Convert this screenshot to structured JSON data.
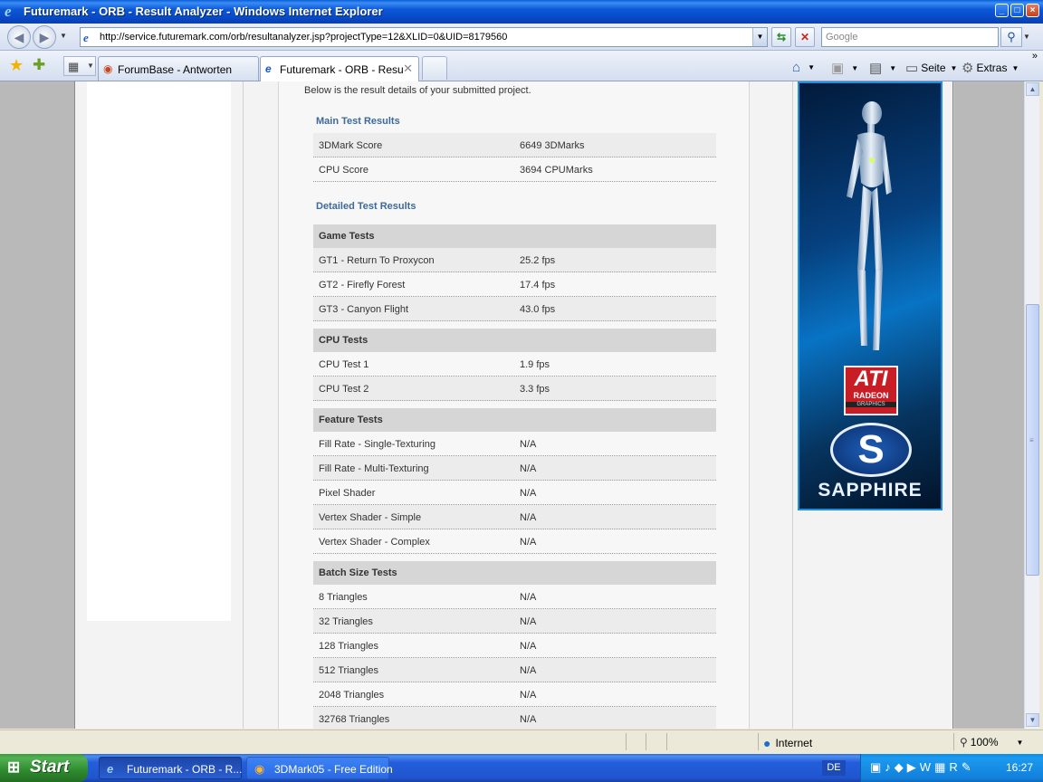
{
  "window": {
    "title": "Futuremark - ORB - Result Analyzer - Windows Internet Explorer",
    "buttons": [
      "_",
      "□",
      "×"
    ]
  },
  "address_bar": {
    "url": "http://service.futuremark.com/orb/resultanalyzer.jsp?projectType=12&XLID=0&UID=8179560",
    "search_placeholder": "Google"
  },
  "tabs": [
    {
      "label": "ForumBase - Antworten",
      "active": false
    },
    {
      "label": "Futuremark - ORB - Resul...",
      "active": true
    }
  ],
  "command_bar": {
    "page_label": "Seite",
    "tools_label": "Extras"
  },
  "page": {
    "intro": "Below is the result details of your submitted project.",
    "main_title": "Main Test Results",
    "main_rows": [
      {
        "k": "3DMark Score",
        "v": "6649 3DMarks"
      },
      {
        "k": "CPU Score",
        "v": "3694 CPUMarks"
      }
    ],
    "detailed_title": "Detailed Test Results",
    "groups": [
      {
        "title": "Game Tests",
        "rows": [
          {
            "k": "GT1 - Return To Proxycon",
            "v": "25.2 fps"
          },
          {
            "k": "GT2 - Firefly Forest",
            "v": "17.4 fps"
          },
          {
            "k": "GT3 - Canyon Flight",
            "v": "43.0 fps"
          }
        ]
      },
      {
        "title": "CPU Tests",
        "rows": [
          {
            "k": "CPU Test 1",
            "v": "1.9 fps"
          },
          {
            "k": "CPU Test 2",
            "v": "3.3 fps"
          }
        ]
      },
      {
        "title": "Feature Tests",
        "rows": [
          {
            "k": "Fill Rate - Single-Texturing",
            "v": "N/A"
          },
          {
            "k": "Fill Rate - Multi-Texturing",
            "v": "N/A"
          },
          {
            "k": "Pixel Shader",
            "v": "N/A"
          },
          {
            "k": "Vertex Shader - Simple",
            "v": "N/A"
          },
          {
            "k": "Vertex Shader - Complex",
            "v": "N/A"
          }
        ]
      },
      {
        "title": "Batch Size Tests",
        "rows": [
          {
            "k": "8 Triangles",
            "v": "N/A"
          },
          {
            "k": "32 Triangles",
            "v": "N/A"
          },
          {
            "k": "128 Triangles",
            "v": "N/A"
          },
          {
            "k": "512 Triangles",
            "v": "N/A"
          },
          {
            "k": "2048 Triangles",
            "v": "N/A"
          },
          {
            "k": "32768 Triangles",
            "v": "N/A"
          }
        ]
      }
    ]
  },
  "ad": {
    "ati_logo": "ATI",
    "ati_sub": "RADEON",
    "ati_graphics": "GRAPHICS",
    "sapphire_mark": "S",
    "sapphire_text": "SAPPHIRE"
  },
  "status_bar": {
    "zone": "Internet",
    "zoom": "100%"
  },
  "taskbar": {
    "start": "Start",
    "tasks": [
      "Futuremark - ORB - R...",
      "3DMark05 - Free Edition"
    ],
    "lang": "DE",
    "clock": "16:27"
  },
  "colors": {
    "section_title": "#3d6a9a",
    "group_header_bg": "#d6d6d6",
    "titlebar": "#0c58d8"
  }
}
